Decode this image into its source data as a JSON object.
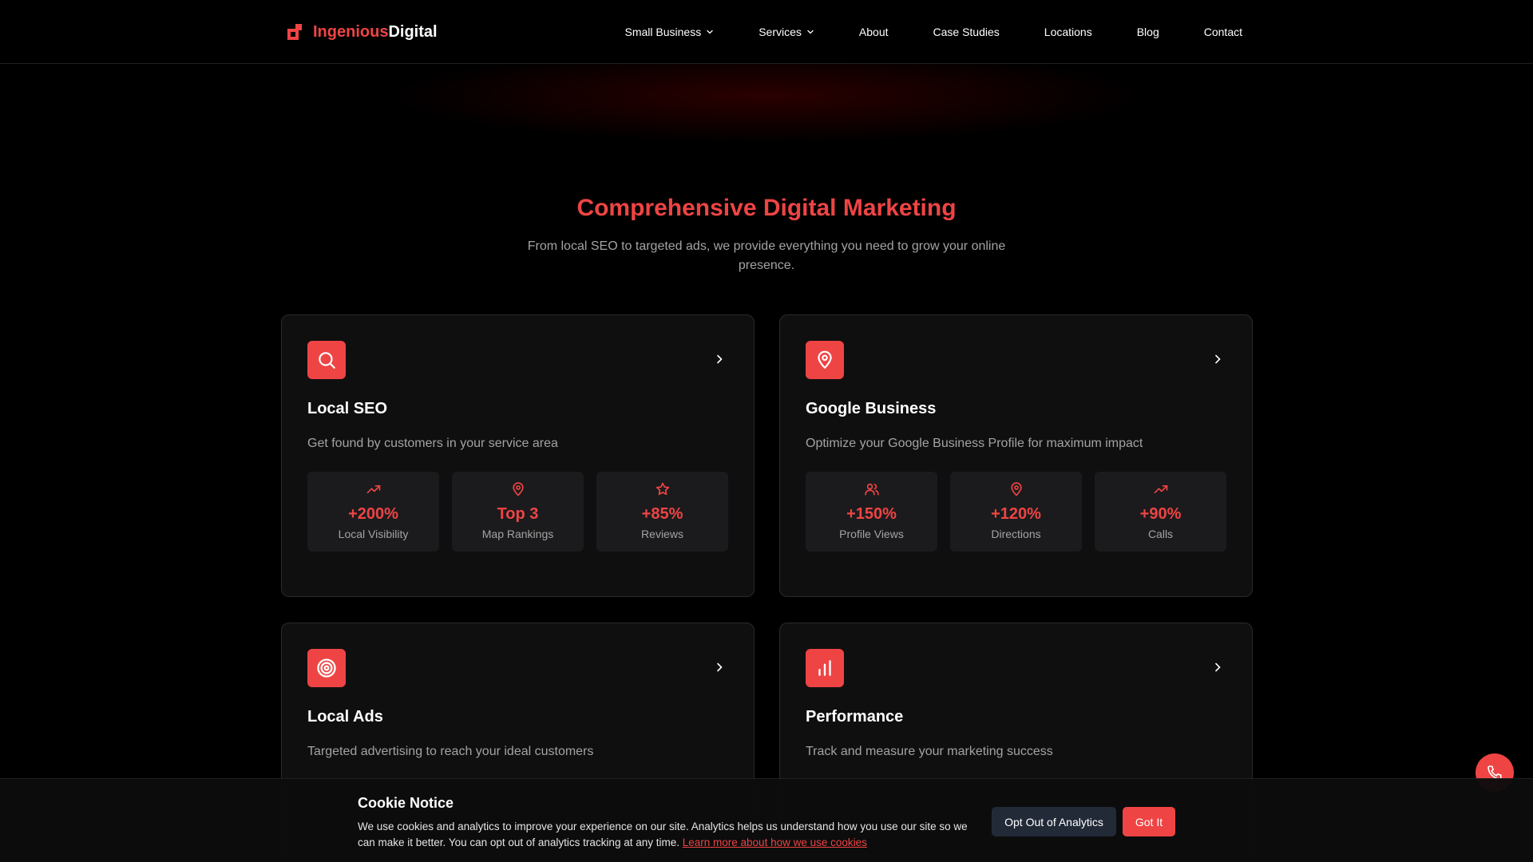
{
  "brand": {
    "part1": "Ingenious",
    "part2": "Digital"
  },
  "nav": [
    {
      "label": "Small Business",
      "dropdown": true
    },
    {
      "label": "Services",
      "dropdown": true
    },
    {
      "label": "About"
    },
    {
      "label": "Case Studies"
    },
    {
      "label": "Locations"
    },
    {
      "label": "Blog"
    },
    {
      "label": "Contact"
    }
  ],
  "hero": {
    "title": "Comprehensive Digital Marketing",
    "subtitle": "From local SEO to targeted ads, we provide everything you need to grow your online presence."
  },
  "cards": [
    {
      "icon": "search-icon",
      "title": "Local SEO",
      "desc": "Get found by customers in your service area",
      "stats": [
        {
          "icon": "trending-up-icon",
          "value": "+200%",
          "label": "Local Visibility"
        },
        {
          "icon": "map-pin-icon",
          "value": "Top 3",
          "label": "Map Rankings"
        },
        {
          "icon": "star-icon",
          "value": "+85%",
          "label": "Reviews"
        }
      ]
    },
    {
      "icon": "map-pin-icon",
      "title": "Google Business",
      "desc": "Optimize your Google Business Profile for maximum impact",
      "stats": [
        {
          "icon": "users-icon",
          "value": "+150%",
          "label": "Profile Views"
        },
        {
          "icon": "map-pin-icon",
          "value": "+120%",
          "label": "Directions"
        },
        {
          "icon": "trending-up-icon",
          "value": "+90%",
          "label": "Calls"
        }
      ]
    },
    {
      "icon": "target-icon",
      "title": "Local Ads",
      "desc": "Targeted advertising to reach your ideal customers"
    },
    {
      "icon": "bar-chart-icon",
      "title": "Performance",
      "desc": "Track and measure your marketing success"
    }
  ],
  "cookie": {
    "title": "Cookie Notice",
    "body": "We use cookies and analytics to improve your experience on our site. Analytics helps us understand how you use our site so we can make it better. You can opt out of analytics tracking at any time.",
    "link": "Learn more about how we use cookies",
    "opt_out": "Opt Out of Analytics",
    "accept": "Got It"
  },
  "colors": {
    "accent": "#ef4444",
    "background": "#000000",
    "card": "#0f0f10"
  }
}
